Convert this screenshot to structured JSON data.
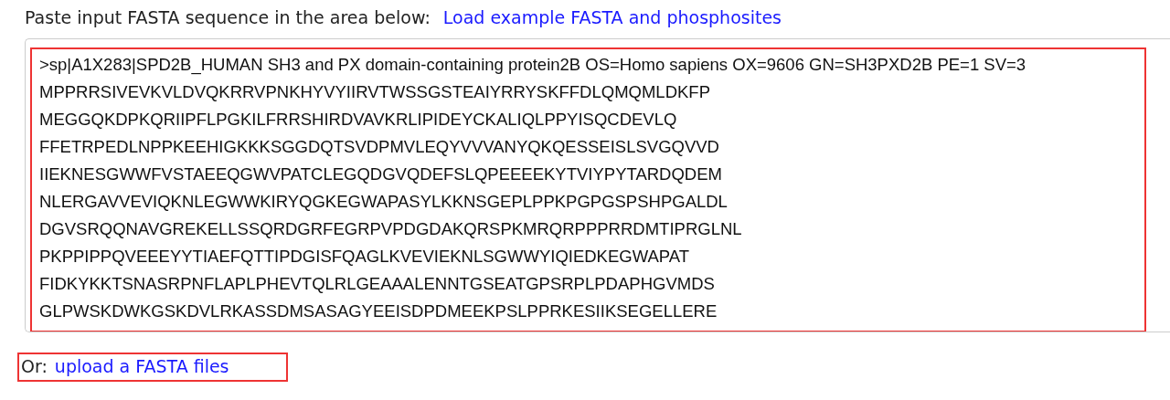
{
  "prompt": {
    "label": "Paste input FASTA sequence in the area below:",
    "link": "Load example FASTA and phosphosites"
  },
  "sequence_input": {
    "highlighted": true,
    "lines": [
      ">sp|A1X283|SPD2B_HUMAN SH3 and PX domain-containing protein2B OS=Homo sapiens OX=9606 GN=SH3PXD2B PE=1 SV=3",
      "MPPRRSIVEVKVLDVQKRRVPNKHYVYIIRVTWSSGSTEAIYRRYSKFFDLQMQMLDKFP",
      "MEGGQKDPKQRIIPFLPGKILFRRSHIRDVAVKRLIPIDEYCKALIQLPPYISQCDEVLQ",
      "FFETRPEDLNPPKEEHIGKKKSGGDQTSVDPMVLEQYVVVANYQKQESSEISLSVGQVVD",
      "IIEKNESGWWFVSTAEEQGWVPATCLEGQDGVQDEFSLQPEEEEKYTVIYPYTARDQDEM",
      "NLERGAVVEVIQKNLEGWWKIRYQGKEGWAPASYLKKNSGEPLPPKPGPGSPSHPGALDL",
      "DGVSRQQNAVGREKELLSSQRDGRFEGRPVPDGDAKQRSPKMRQRPPPRRDMTIPRGLNL",
      "PKPPIPPQVEEEYYTIAEFQTTIPDGISFQAGLKVEVIEKNLSGWWYIQIEDKEGWAPAT",
      "FIDKYKKTSNASRPNFLAPLPHEVTQLRLGEAAALENNTGSEATGPSRPLPDAPHGVMDS",
      "GLPWSKDWKGSKDVLRKASSDMSASAGYEEISDPDMEEKPSLPPRKESIIKSEGELLERE"
    ]
  },
  "upload": {
    "highlighted": true,
    "label": "Or:",
    "link": "upload a FASTA files"
  }
}
